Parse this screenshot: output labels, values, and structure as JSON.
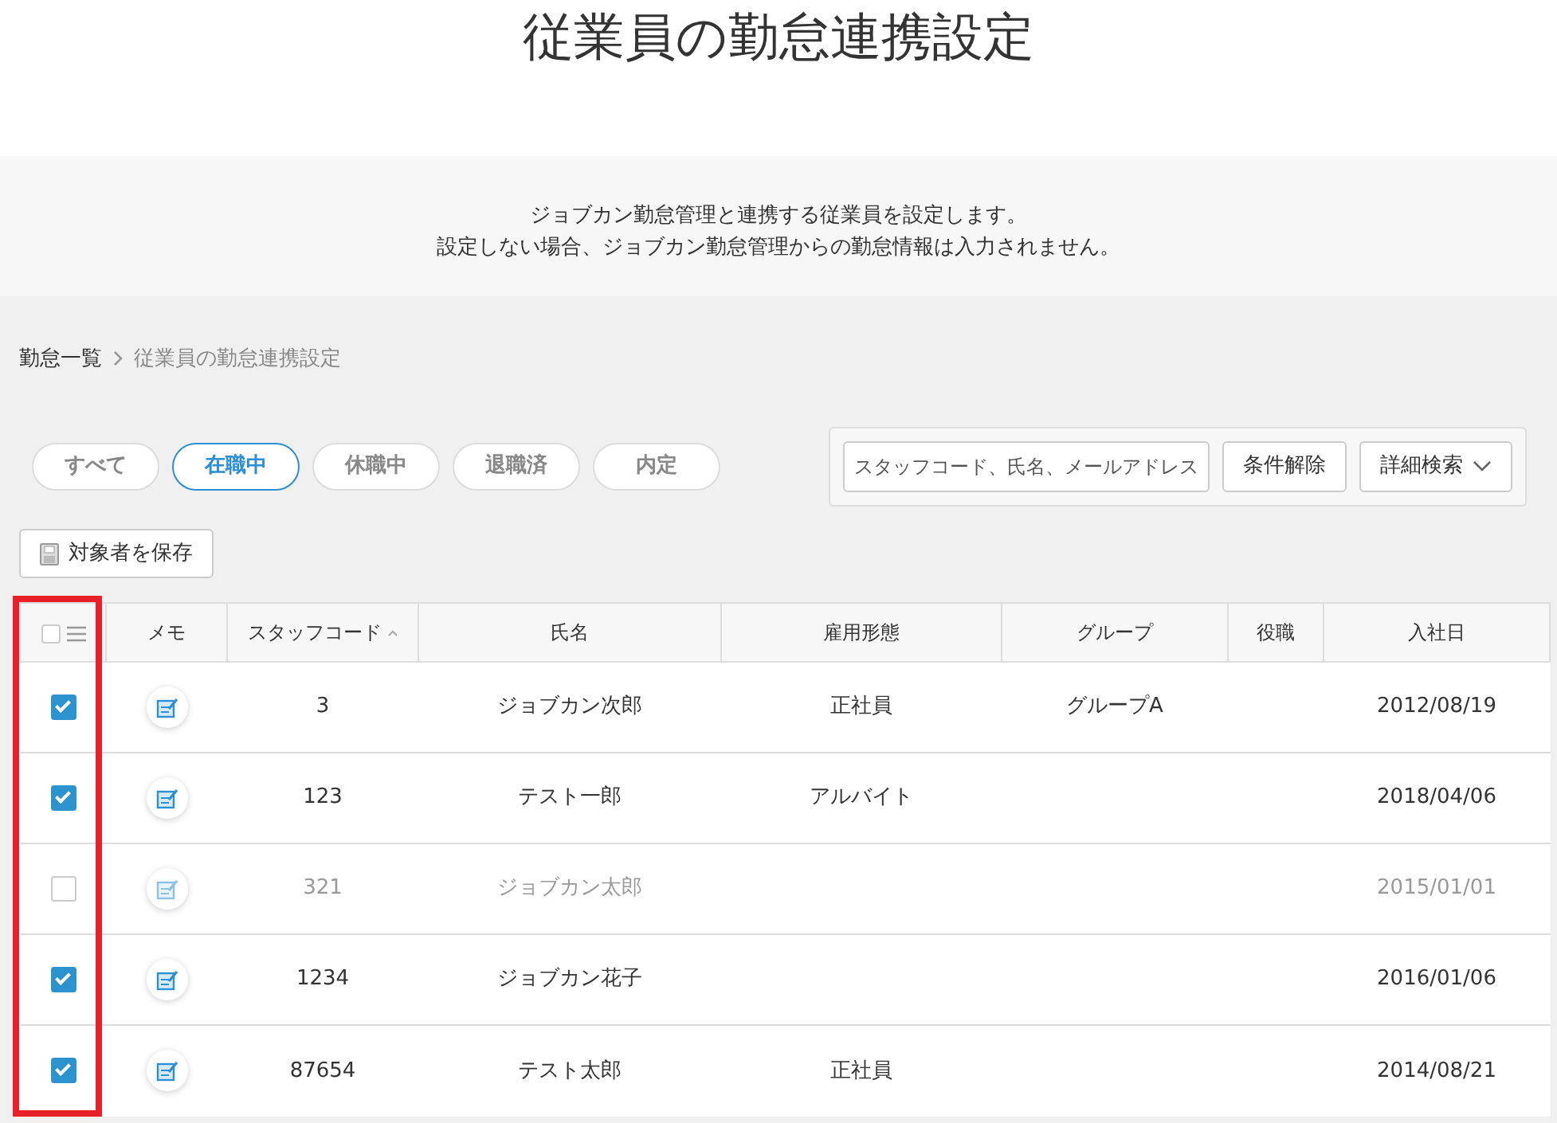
{
  "page_title": "従業員の勤怠連携設定",
  "description": [
    "ジョブカン勤怠管理と連携する従業員を設定します。",
    "設定しない場合、ジョブカン勤怠管理からの勤怠情報は入力されません。"
  ],
  "breadcrumb": [
    {
      "label": "勤怠一覧",
      "current": false
    },
    {
      "label": "従業員の勤怠連携設定",
      "current": true
    }
  ],
  "filters": [
    {
      "label": "すべて",
      "selected": false
    },
    {
      "label": "在職中",
      "selected": true
    },
    {
      "label": "休職中",
      "selected": false
    },
    {
      "label": "退職済",
      "selected": false
    },
    {
      "label": "内定",
      "selected": false
    }
  ],
  "search": {
    "placeholder": "スタッフコード、氏名、メールアドレス",
    "clear_button": "条件解除",
    "advanced_button": "詳細検索"
  },
  "save_button": "対象者を保存",
  "table": {
    "columns": [
      "メモ",
      "スタッフコード",
      "氏名",
      "雇用形態",
      "グループ",
      "役職",
      "入社日"
    ],
    "select_all_checked": false,
    "rows": [
      {
        "checked": true,
        "code": "3",
        "name": "ジョブカン次郎",
        "employment": "正社員",
        "group": "グループA",
        "role": "",
        "joined": "2012/08/19"
      },
      {
        "checked": true,
        "code": "123",
        "name": "テスト一郎",
        "employment": "アルバイト",
        "group": "",
        "role": "",
        "joined": "2018/04/06"
      },
      {
        "checked": false,
        "code": "321",
        "name": "ジョブカン太郎",
        "employment": "",
        "group": "",
        "role": "",
        "joined": "2015/01/01"
      },
      {
        "checked": true,
        "code": "1234",
        "name": "ジョブカン花子",
        "employment": "",
        "group": "",
        "role": "",
        "joined": "2016/01/06"
      },
      {
        "checked": true,
        "code": "87654",
        "name": "テスト太郎",
        "employment": "正社員",
        "group": "",
        "role": "",
        "joined": "2014/08/21"
      }
    ]
  }
}
